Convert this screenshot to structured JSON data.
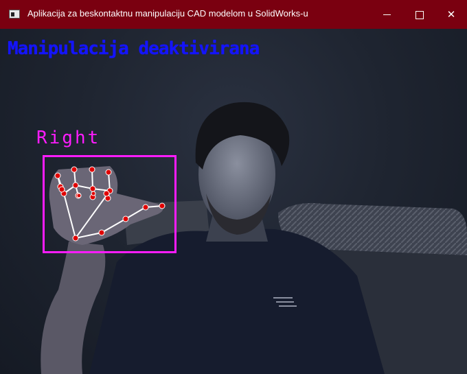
{
  "window": {
    "title": "Aplikacija za beskontaktnu manipulaciju CAD modelom u SolidWorks-u",
    "icon": "app-window-icon",
    "controls": {
      "minimize": "minimize-icon",
      "maximize": "maximize-icon",
      "close": "close-icon",
      "close_glyph": "✕"
    },
    "titlebar_color": "#7a0010"
  },
  "overlay": {
    "status_text": "Manipulacija deaktivirana",
    "status_color": "#1414ff",
    "hand_label": "Right",
    "hand_color": "#ff1cff",
    "landmark_color": "#e00000",
    "connection_color": "#ffffff"
  }
}
